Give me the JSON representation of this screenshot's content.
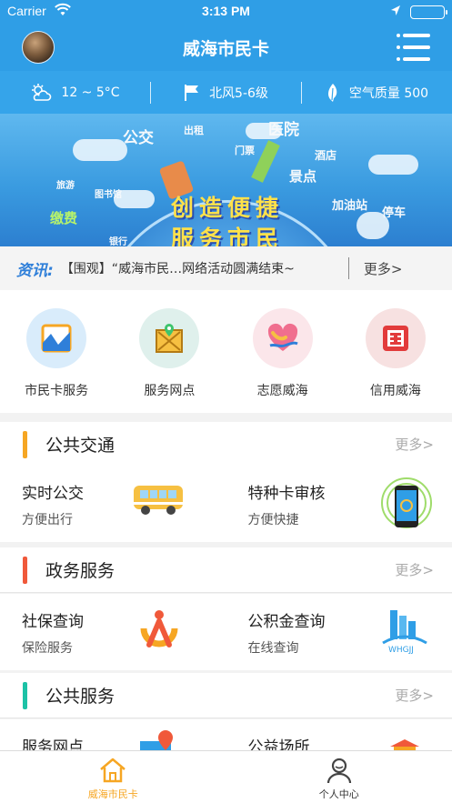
{
  "status_bar": {
    "carrier": "Carrier",
    "time": "3:13 PM"
  },
  "header": {
    "title": "威海市民卡",
    "avatar_icon": "avatar",
    "menu_icon": "list-menu-icon"
  },
  "weather": {
    "temperature": "12 ~ 5°C",
    "wind": "北风5-6级",
    "air_quality": "空气质量 500"
  },
  "banner": {
    "slogan_line1": "创造便捷",
    "slogan_line2": "服务市民",
    "words": [
      "公交",
      "医院",
      "出租",
      "门票",
      "酒店",
      "景点",
      "加油站",
      "停车",
      "图书馆",
      "缴费",
      "旅游",
      "银行"
    ]
  },
  "news": {
    "tag": "资讯:",
    "text": "【围观】“威海市民…网络活动圆满结束~",
    "more": "更多>"
  },
  "quick_links": [
    {
      "label": "市民卡服务",
      "icon": "card-chart-icon",
      "color": "#d9ecfb"
    },
    {
      "label": "服务网点",
      "icon": "map-pin-icon",
      "color": "#dff0ec"
    },
    {
      "label": "志愿威海",
      "icon": "heart-hands-icon",
      "color": "#fbe6ea"
    },
    {
      "label": "信用威海",
      "icon": "credit-badge-icon",
      "color": "#f7e1e1"
    }
  ],
  "sections": [
    {
      "title": "公共交通",
      "more": "更多>",
      "accent": "#f6a623",
      "items": [
        {
          "name": "实时公交",
          "desc": "方便出行",
          "icon": "bus-icon"
        },
        {
          "name": "特种卡审核",
          "desc": "方便快捷",
          "icon": "nfc-phone-icon"
        }
      ]
    },
    {
      "title": "政务服务",
      "more": "更多>",
      "accent": "#f0593a",
      "items": [
        {
          "name": "社保查询",
          "desc": "保险服务",
          "icon": "social-security-logo-icon"
        },
        {
          "name": "公积金查询",
          "desc": "在线查询",
          "icon": "whgjj-logo-icon"
        }
      ]
    },
    {
      "title": "公共服务",
      "more": "更多>",
      "accent": "#1cc2a6",
      "items": [
        {
          "name": "服务网点",
          "desc": "",
          "icon": "map-location-icon"
        },
        {
          "name": "公益场所",
          "desc": "",
          "icon": "building-icon"
        }
      ]
    }
  ],
  "tabs": [
    {
      "label": "威海市民卡",
      "icon": "home-icon",
      "active": true
    },
    {
      "label": "个人中心",
      "icon": "person-icon",
      "active": false
    }
  ]
}
